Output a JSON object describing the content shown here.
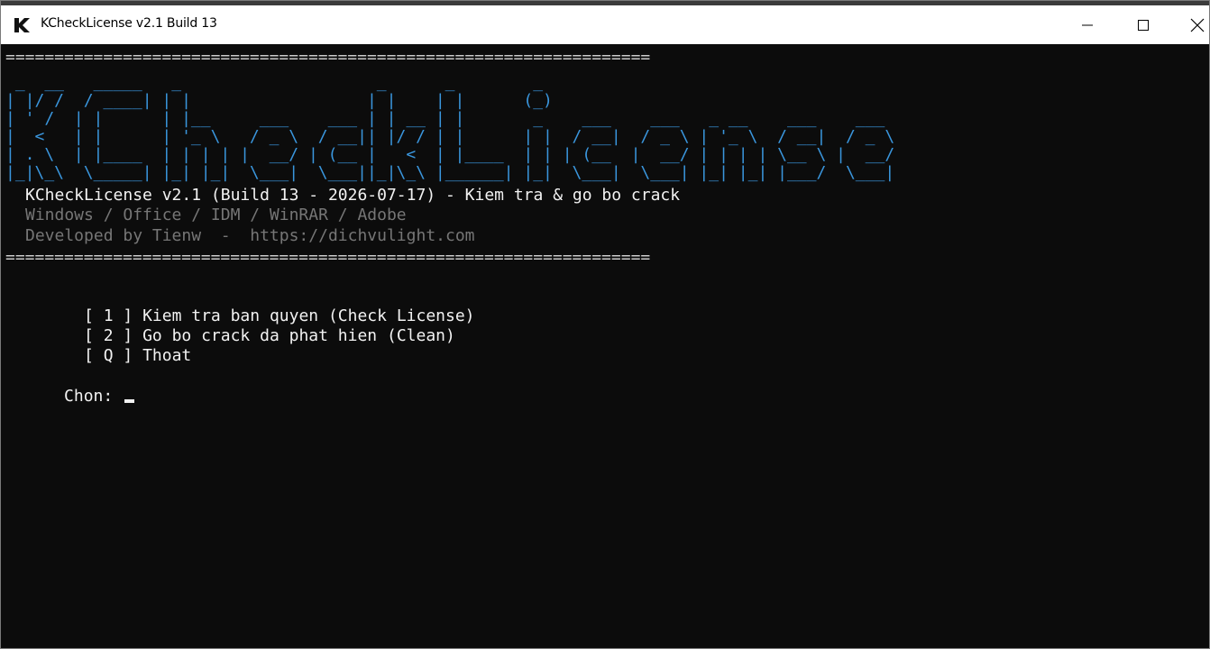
{
  "window": {
    "title": "KCheckLicense v2.1 Build 13",
    "icon": "k-logo-icon"
  },
  "controls": {
    "minimize": "minimize-icon",
    "maximize": "maximize-icon",
    "close": "close-icon"
  },
  "console": {
    "separator": "==================================================================",
    "banner": [
      " _  __   _____   _                    _      _        _",
      "| |/ /  / ____| | |                  | |    | |      (_)",
      "| ' /  | |      | |__     ___    ___ | | __ | |       _    ___    ___   _ __    ___    ___",
      "|  <   | |      | '_ \\   / _ \\  / __|| |/ / | |      | |  / __|  / _ \\ | '_ \\  / __|  / _ \\",
      "| . \\  | |____  | | | | |  __/ | (__ |   <  | |____  | | | (__  |  __/ | | | | \\__ \\ |  __/",
      "|_|\\_\\  \\_____| |_| |_|  \\___|  \\___||_|\\_\\ |______| |_|  \\___|  \\___| |_| |_| |___/  \\___|"
    ],
    "header_title": "KCheckLicense v2.1 (Build 13 - 2026-07-17) - Kiem tra & go bo crack",
    "header_products": "Windows / Office / IDM / WinRAR / Adobe",
    "header_dev": "Developed by Tienw  -  https://dichvulight.com",
    "menu": [
      {
        "key": "[ 1 ]",
        "label": "Kiem tra ban quyen (Check License)"
      },
      {
        "key": "[ 2 ]",
        "label": "Go bo crack da phat hien (Clean)"
      },
      {
        "key": "[ Q ]",
        "label": "Thoat"
      }
    ],
    "prompt": "Chon: "
  },
  "colors": {
    "background": "#0c0c0c",
    "ascii": "#3a96dd",
    "text": "#f2f2f2",
    "dim": "#767676"
  }
}
